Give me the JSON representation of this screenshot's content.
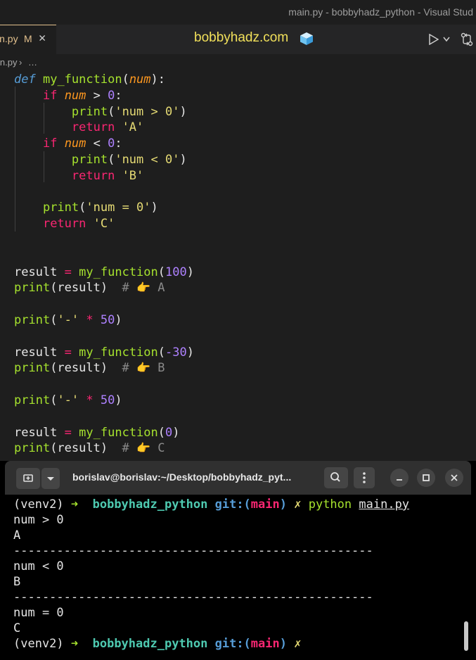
{
  "window": {
    "title": "main.py - bobbyhadz_python - Visual Stud"
  },
  "tab": {
    "filename": "in.py",
    "modified": "M",
    "close": "✕"
  },
  "header": {
    "site": "bobbyhadz.com"
  },
  "breadcrumb": {
    "file": "in.py",
    "sep": "›",
    "more": "…"
  },
  "colors": {
    "keyword": "#569cd6",
    "control": "#f92672",
    "func": "#a6e22e",
    "param": "#fd971f",
    "string": "#e6db74",
    "number": "#ae81ff",
    "comment": "#8a8a8a",
    "teal": "#4ec9b0"
  },
  "code": [
    [
      [
        "def",
        "kw"
      ],
      [
        " ",
        ""
      ],
      [
        "my_function",
        "fn"
      ],
      [
        "(",
        ""
      ],
      [
        "num",
        "pa"
      ],
      [
        "):",
        ""
      ]
    ],
    [
      [
        "    ",
        ""
      ],
      [
        "if",
        "ct"
      ],
      [
        " ",
        ""
      ],
      [
        "num",
        "pa"
      ],
      [
        " > ",
        ""
      ],
      [
        "0",
        "nu"
      ],
      [
        ":",
        ""
      ]
    ],
    [
      [
        "        ",
        ""
      ],
      [
        "print",
        "fn"
      ],
      [
        "(",
        ""
      ],
      [
        "'num > 0'",
        "st"
      ],
      [
        ")",
        ""
      ]
    ],
    [
      [
        "        ",
        ""
      ],
      [
        "return",
        "ct"
      ],
      [
        " ",
        ""
      ],
      [
        "'A'",
        "st"
      ]
    ],
    [
      [
        "    ",
        ""
      ],
      [
        "if",
        "ct"
      ],
      [
        " ",
        ""
      ],
      [
        "num",
        "pa"
      ],
      [
        " < ",
        ""
      ],
      [
        "0",
        "nu"
      ],
      [
        ":",
        ""
      ]
    ],
    [
      [
        "        ",
        ""
      ],
      [
        "print",
        "fn"
      ],
      [
        "(",
        ""
      ],
      [
        "'num < 0'",
        "st"
      ],
      [
        ")",
        ""
      ]
    ],
    [
      [
        "        ",
        ""
      ],
      [
        "return",
        "ct"
      ],
      [
        " ",
        ""
      ],
      [
        "'B'",
        "st"
      ]
    ],
    [],
    [
      [
        "    ",
        ""
      ],
      [
        "print",
        "fn"
      ],
      [
        "(",
        ""
      ],
      [
        "'num = 0'",
        "st"
      ],
      [
        ")",
        ""
      ]
    ],
    [
      [
        "    ",
        ""
      ],
      [
        "return",
        "ct"
      ],
      [
        " ",
        ""
      ],
      [
        "'C'",
        "st"
      ]
    ],
    [],
    [],
    [
      [
        "result",
        ""
      ],
      [
        " ",
        ""
      ],
      [
        "=",
        "ct"
      ],
      [
        " ",
        ""
      ],
      [
        "my_function",
        "fn"
      ],
      [
        "(",
        ""
      ],
      [
        "100",
        "nu"
      ],
      [
        ")",
        ""
      ]
    ],
    [
      [
        "print",
        "fn"
      ],
      [
        "(result)",
        ""
      ],
      [
        "  # ",
        "cm"
      ],
      [
        "👉",
        "em"
      ],
      [
        " A",
        "cm"
      ]
    ],
    [],
    [
      [
        "print",
        "fn"
      ],
      [
        "(",
        ""
      ],
      [
        "'-'",
        "st"
      ],
      [
        " ",
        ""
      ],
      [
        "*",
        "ct"
      ],
      [
        " ",
        ""
      ],
      [
        "50",
        "nu"
      ],
      [
        ")",
        ""
      ]
    ],
    [],
    [
      [
        "result",
        ""
      ],
      [
        " ",
        ""
      ],
      [
        "=",
        "ct"
      ],
      [
        " ",
        ""
      ],
      [
        "my_function",
        "fn"
      ],
      [
        "(",
        ""
      ],
      [
        "-30",
        "nu"
      ],
      [
        ")",
        ""
      ]
    ],
    [
      [
        "print",
        "fn"
      ],
      [
        "(result)",
        ""
      ],
      [
        "  # ",
        "cm"
      ],
      [
        "👉",
        "em"
      ],
      [
        " B",
        "cm"
      ]
    ],
    [],
    [
      [
        "print",
        "fn"
      ],
      [
        "(",
        ""
      ],
      [
        "'-'",
        "st"
      ],
      [
        " ",
        ""
      ],
      [
        "*",
        "ct"
      ],
      [
        " ",
        ""
      ],
      [
        "50",
        "nu"
      ],
      [
        ")",
        ""
      ]
    ],
    [],
    [
      [
        "result",
        ""
      ],
      [
        " ",
        ""
      ],
      [
        "=",
        "ct"
      ],
      [
        " ",
        ""
      ],
      [
        "my_function",
        "fn"
      ],
      [
        "(",
        ""
      ],
      [
        "0",
        "nu"
      ],
      [
        ")",
        ""
      ]
    ],
    [
      [
        "print",
        "fn"
      ],
      [
        "(result)",
        ""
      ],
      [
        "  # ",
        "cm"
      ],
      [
        "👉",
        "em"
      ],
      [
        " C",
        "cm"
      ]
    ]
  ],
  "terminal": {
    "title": "borislav@borislav:~/Desktop/bobbyhadz_pyt...",
    "lines": [
      [
        [
          "(venv2) ",
          "tw"
        ],
        [
          "➜ ",
          "tg"
        ],
        [
          " bobbyhadz_python ",
          "tc"
        ],
        [
          "git:(",
          "tb"
        ],
        [
          "main",
          "tr"
        ],
        [
          ")",
          "tb"
        ],
        [
          " ✗ ",
          "ty"
        ],
        [
          "python",
          "tgr"
        ],
        [
          " ",
          ""
        ],
        [
          "main.py",
          "tu"
        ]
      ],
      [
        [
          "num > 0",
          ""
        ]
      ],
      [
        [
          "A",
          ""
        ]
      ],
      [
        [
          "--------------------------------------------------",
          ""
        ]
      ],
      [
        [
          "num < 0",
          ""
        ]
      ],
      [
        [
          "B",
          ""
        ]
      ],
      [
        [
          "--------------------------------------------------",
          ""
        ]
      ],
      [
        [
          "num = 0",
          ""
        ]
      ],
      [
        [
          "C",
          ""
        ]
      ],
      [
        [
          "(venv2) ",
          "tw"
        ],
        [
          "➜ ",
          "tg"
        ],
        [
          " bobbyhadz_python ",
          "tc"
        ],
        [
          "git:(",
          "tb"
        ],
        [
          "main",
          "tr"
        ],
        [
          ")",
          "tb"
        ],
        [
          " ✗",
          "ty"
        ]
      ]
    ]
  }
}
